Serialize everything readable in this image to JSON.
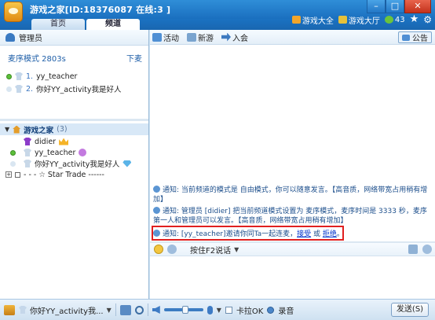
{
  "window": {
    "title": "游戏之家[ID:18376087 在线:3 ]",
    "controls": [
      "–",
      "□",
      "✕"
    ]
  },
  "tabs": [
    {
      "label": "首页",
      "active": false
    },
    {
      "label": "频道",
      "active": true
    }
  ],
  "toplinks": {
    "games": "游戏大全",
    "hall": "游戏大厅",
    "level": "43"
  },
  "left": {
    "header": "管理员",
    "mode_label": "麦序模式 2803s",
    "mode_more": "下麦",
    "queue": [
      {
        "num": "1.",
        "name": "yy_teacher",
        "online": true
      },
      {
        "num": "2.",
        "name": "你好YY_activity我是好人",
        "online": false
      }
    ],
    "channel": {
      "name": "游戏之家",
      "count": "(3)"
    },
    "users": [
      {
        "name": "didier"
      },
      {
        "name": "yy_teacher"
      },
      {
        "name": "你好YY_activity我是好人"
      }
    ],
    "subchannel": "- - - ☆ Star Trade ------"
  },
  "right": {
    "toolbar": {
      "activity": "活动",
      "newgame": "新游",
      "enter": "入会",
      "notice": "公告"
    },
    "messages": [
      {
        "prefix": "通知:",
        "text": "当前频道的模式是 自由模式，你可以随意发言。【高音质，网络带宽占用稍有增加】"
      },
      {
        "prefix": "通知:",
        "text": "管理员 [didier] 把当前频道模式设置为 麦序模式，麦序时间是 3333 秒，麦序第一人和管理员可以发言。【高音质，网络带宽占用稍有增加】"
      },
      {
        "prefix": "通知:",
        "text": "[yy_teacher]邀请你同Ta一起连麦，",
        "accept": "接受",
        "or": " 或 ",
        "reject": "拒绝",
        "end": "。"
      }
    ],
    "input_mode": "按住F2说话"
  },
  "bottom": {
    "user": "你好YY_activity我...",
    "karaoke": "卡拉OK",
    "record": "录音",
    "send": "发送(S)"
  }
}
